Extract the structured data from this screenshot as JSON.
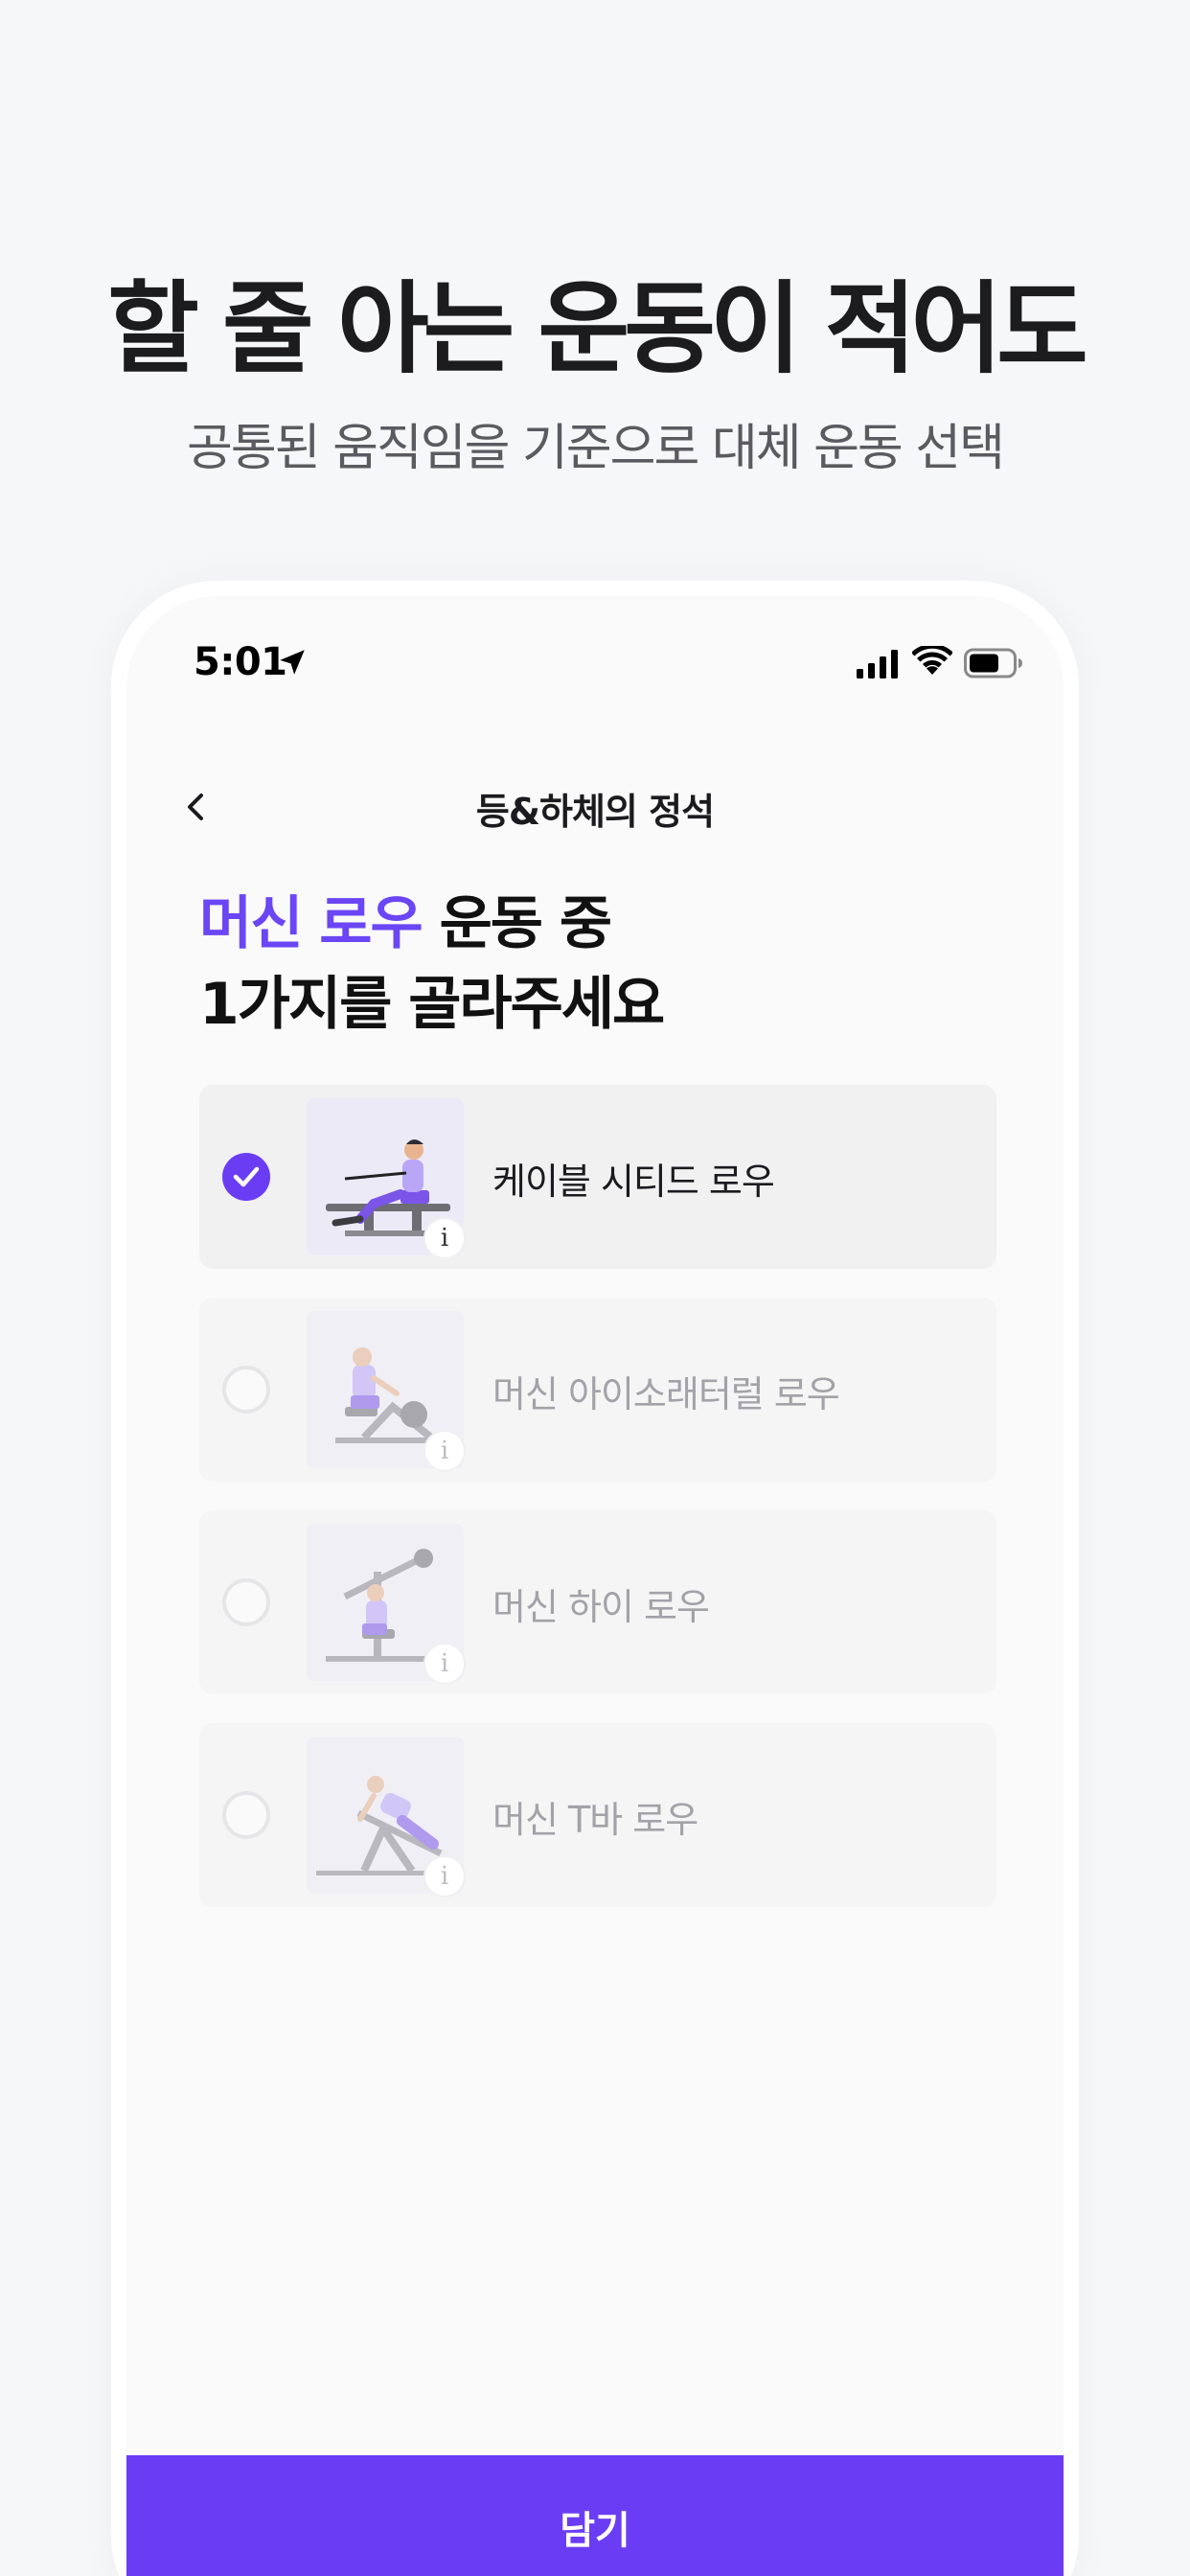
{
  "marketing": {
    "headline": "할 줄 아는 운동이 적어도",
    "subheadline": "공통된 움직임을 기준으로 대체 운동 선택"
  },
  "status_bar": {
    "time": "5:01"
  },
  "nav": {
    "title": "등&하체의 정석"
  },
  "question": {
    "accent": "머신 로우",
    "line1_rest": " 운동 중",
    "line2": "1가지를 골라주세요"
  },
  "options": [
    {
      "label": "케이블 시티드 로우",
      "selected": true,
      "info": "i"
    },
    {
      "label": "머신 아이소래터럴 로우",
      "selected": false,
      "info": "i"
    },
    {
      "label": "머신 하이 로우",
      "selected": false,
      "info": "i"
    },
    {
      "label": "머신 T바 로우",
      "selected": false,
      "info": "i"
    }
  ],
  "cta": {
    "label": "담기"
  },
  "colors": {
    "accent": "#6a3df5",
    "headline_accent": "#6a46f5",
    "background": "#f6f7f9"
  },
  "icons": [
    "location-arrow-icon",
    "signal-icon",
    "wifi-icon",
    "battery-icon",
    "back-chevron-icon",
    "check-icon",
    "info-icon"
  ]
}
